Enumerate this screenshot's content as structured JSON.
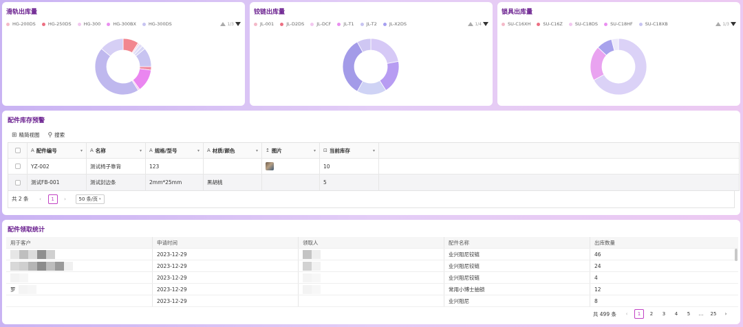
{
  "charts": [
    {
      "title": "滑轨出库量",
      "legend": [
        "HG-200DS",
        "HG-250DS",
        "HG-300",
        "HG-300BX",
        "HG-300DS"
      ],
      "legend_colors": [
        "#f4b9c8",
        "#ec6f82",
        "#f2c7ef",
        "#ea8ff0",
        "#c7c4f1"
      ],
      "legend_pager": "1/3"
    },
    {
      "title": "铰链出库量",
      "legend": [
        "JL-001",
        "JL-D2DS",
        "JL-DCF",
        "JL-T1",
        "JL-T2",
        "JL-X2DS"
      ],
      "legend_colors": [
        "#f4b9c8",
        "#ec6f82",
        "#f2c7ef",
        "#ea8ff0",
        "#c7c4f1",
        "#a69ff0"
      ],
      "legend_pager": "1/4"
    },
    {
      "title": "锁具出库量",
      "legend": [
        "SU-C16XH",
        "SU-C16Z",
        "SU-C18DS",
        "SU-C18HF",
        "SU-C18XB"
      ],
      "legend_colors": [
        "#f4b9c8",
        "#ec6f82",
        "#f2c7ef",
        "#ea8ff0",
        "#c7c4f1"
      ],
      "legend_pager": "1/3"
    }
  ],
  "chart_data": [
    {
      "type": "pie",
      "title": "滑轨出库量",
      "series": [
        {
          "values": [
            0.09,
            0.01,
            0.02,
            0.02,
            0.11,
            0.02,
            0.13,
            0.01,
            0.45,
            0.14
          ]
        }
      ],
      "colors": [
        "#f2868f",
        "#f4d2e0",
        "#e2ddf7",
        "#d8d6f6",
        "#c8c4f1",
        "#f08ba1",
        "#ea86f0",
        "#f6c9ef",
        "#bfb8ee",
        "#d6cff5"
      ]
    },
    {
      "type": "pie",
      "title": "铰链出库量",
      "series": [
        {
          "values": [
            0.22,
            0.19,
            0.17,
            0.34,
            0.08
          ]
        }
      ],
      "colors": [
        "#d6c9f6",
        "#b79cf2",
        "#cfd3f5",
        "#a39be8",
        "#cfc7f3"
      ]
    },
    {
      "type": "pie",
      "title": "锁具出库量",
      "series": [
        {
          "values": [
            0.67,
            0.2,
            0.09,
            0.04
          ]
        }
      ],
      "colors": [
        "#dbd2f7",
        "#e9a3f0",
        "#a8a2ec",
        "#ece9fb"
      ]
    }
  ],
  "inventory": {
    "title": "配件库存预警",
    "toolbar": {
      "view_label": "精简视图",
      "search_label": "搜索"
    },
    "columns": [
      "配件编号",
      "名称",
      "规格/型号",
      "材质/颜色",
      "图片",
      "当前库存"
    ],
    "column_icons": [
      "A",
      "A",
      "A",
      "A",
      "↥",
      "⊡"
    ],
    "rows": [
      {
        "code": "YZ-002",
        "name": "测试椅子靠背",
        "spec": "123",
        "material": "",
        "stock": "10"
      },
      {
        "code": "测试FB-001",
        "name": "测试封边条",
        "spec": "2mm*25mm",
        "material": "黑胡桃",
        "stock": "5"
      }
    ],
    "footer": {
      "total": "共 2 条",
      "current_page": "1",
      "page_size": "50 条/页"
    }
  },
  "stats": {
    "title": "配件领取统计",
    "columns": [
      "用于客户",
      "申请时间",
      "领取人",
      "配件名称",
      "出库数量"
    ],
    "rows": [
      {
        "customer": "",
        "date": "2023-12-29",
        "receiver": "",
        "part": "业兴阻尼铰链",
        "qty": "46"
      },
      {
        "customer": "",
        "date": "2023-12-29",
        "receiver": "",
        "part": "业兴阻尼铰链",
        "qty": "24"
      },
      {
        "customer": "",
        "date": "2023-12-29",
        "receiver": "",
        "part": "业兴阻尼铰链",
        "qty": "4"
      },
      {
        "customer": "罗",
        "date": "2023-12-29",
        "receiver": "",
        "part": "常用小博士抽锁",
        "qty": "12"
      },
      {
        "customer": "",
        "date": "2023-12-29",
        "receiver": "",
        "part": "业兴阻尼",
        "qty": "8"
      }
    ],
    "footer": {
      "total": "共 499 条",
      "pages": [
        "1",
        "2",
        "3",
        "4",
        "5",
        "…",
        "25"
      ]
    }
  }
}
